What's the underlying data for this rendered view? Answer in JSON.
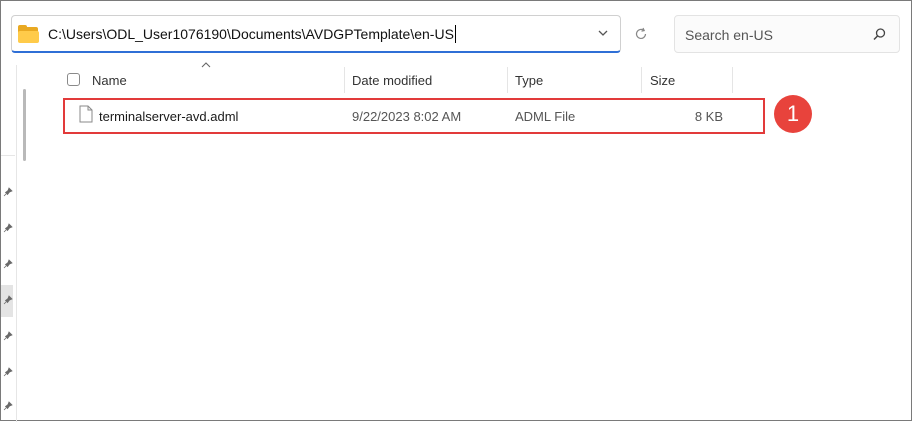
{
  "address_bar": {
    "path": "C:\\Users\\ODL_User1076190\\Documents\\AVDGPTemplate\\en-US"
  },
  "search": {
    "placeholder": "Search en-US"
  },
  "columns": {
    "name": "Name",
    "date_modified": "Date modified",
    "type": "Type",
    "size": "Size"
  },
  "files": [
    {
      "name": "terminalserver-avd.adml",
      "date_modified": "9/22/2023 8:02 AM",
      "type": "ADML File",
      "size": "8 KB"
    }
  ],
  "annotation": {
    "step_number": "1",
    "color": "#e8433c",
    "highlight_color": "#e23a3a"
  },
  "icons": [
    "folder-icon",
    "chevron-down-icon",
    "refresh-icon",
    "search-icon",
    "file-icon",
    "pin-icon",
    "sort-up-icon"
  ]
}
